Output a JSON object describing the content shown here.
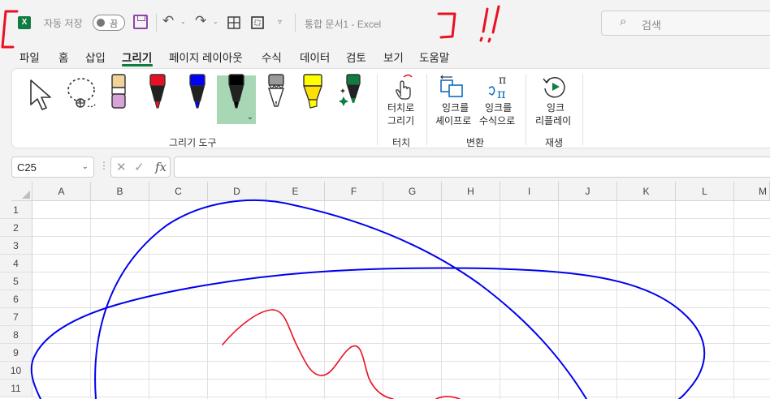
{
  "titlebar": {
    "app_icon_text": "X",
    "autosave_label": "자동 저장",
    "autosave_state": "끔",
    "doc_title": "통합 문서1  -  Excel",
    "search_placeholder": "검색"
  },
  "tabs": [
    {
      "label": "파일"
    },
    {
      "label": "홈"
    },
    {
      "label": "삽입"
    },
    {
      "label": "그리기",
      "active": true
    },
    {
      "label": "페이지 레이아웃"
    },
    {
      "label": "수식"
    },
    {
      "label": "데이터"
    },
    {
      "label": "검토"
    },
    {
      "label": "보기"
    },
    {
      "label": "도움말"
    }
  ],
  "ribbon": {
    "groups": {
      "drawing_tools": "그리기 도구",
      "touch": "터치",
      "convert": "변환",
      "replay": "재생"
    },
    "buttons": {
      "touch_draw_line1": "터치로",
      "touch_draw_line2": "그리기",
      "ink_to_shape_line1": "잉크를",
      "ink_to_shape_line2": "셰이프로",
      "ink_to_math_line1": "잉크를",
      "ink_to_math_line2": "수식으로",
      "ink_replay_line1": "잉크",
      "ink_replay_line2": "리플레이"
    },
    "pens": [
      {
        "name": "pencil-beige",
        "color": "#f2d29b"
      },
      {
        "name": "pen-red",
        "color": "#e81123"
      },
      {
        "name": "pen-blue",
        "color": "#0000ff"
      },
      {
        "name": "pen-black",
        "color": "#000000",
        "selected": true
      },
      {
        "name": "pencil-gray",
        "color": "#8a8a8a"
      },
      {
        "name": "highlighter-yellow",
        "color": "#ffff00"
      },
      {
        "name": "action-pen-green",
        "color": "#107c41"
      }
    ]
  },
  "formula_bar": {
    "name_box": "C25",
    "fx_label": "fx",
    "formula": ""
  },
  "grid": {
    "columns": [
      "A",
      "B",
      "C",
      "D",
      "E",
      "F",
      "G",
      "H",
      "I",
      "J",
      "K",
      "L",
      "M"
    ],
    "rows": [
      "1",
      "2",
      "3",
      "4",
      "5",
      "6",
      "7",
      "8",
      "9",
      "10",
      "11"
    ]
  },
  "ink_colors": {
    "red": "#e81123",
    "blue": "#0000ee"
  }
}
